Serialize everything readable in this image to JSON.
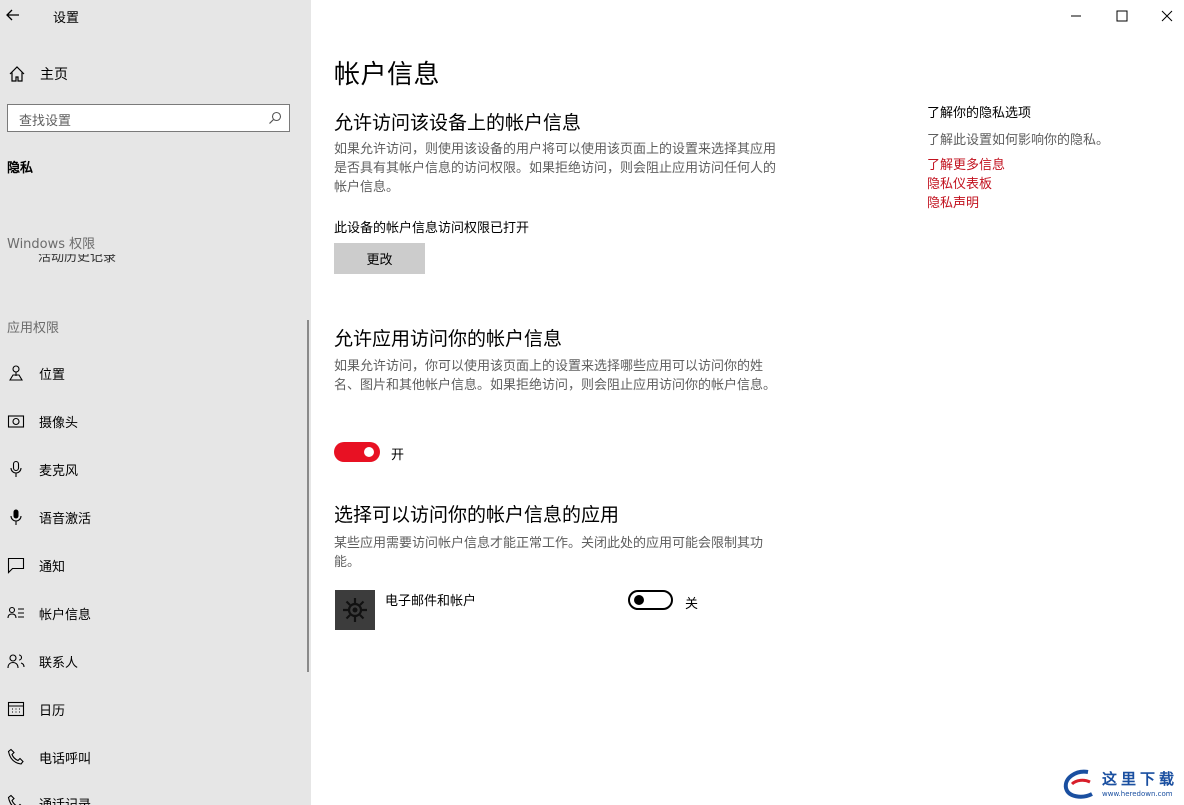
{
  "window": {
    "title": "设置"
  },
  "sidebar": {
    "home_label": "主页",
    "search_placeholder": "查找设置",
    "privacy_heading": "隐私",
    "windows_permissions_heading": "Windows 权限",
    "cut_item_label": "活动历史记录",
    "app_permissions_heading": "应用权限",
    "items": [
      {
        "label": "位置",
        "icon": "location-icon"
      },
      {
        "label": "摄像头",
        "icon": "camera-icon"
      },
      {
        "label": "麦克风",
        "icon": "microphone-icon"
      },
      {
        "label": "语音激活",
        "icon": "voice-activation-icon"
      },
      {
        "label": "通知",
        "icon": "notification-icon"
      },
      {
        "label": "帐户信息",
        "icon": "account-info-icon"
      },
      {
        "label": "联系人",
        "icon": "contacts-icon"
      },
      {
        "label": "日历",
        "icon": "calendar-icon"
      },
      {
        "label": "电话呼叫",
        "icon": "phone-icon"
      },
      {
        "label": "通话记录",
        "icon": "call-history-icon"
      }
    ]
  },
  "main": {
    "title": "帐户信息",
    "section1": {
      "heading": "允许访问该设备上的帐户信息",
      "description": "如果允许访问，则使用该设备的用户将可以使用该页面上的设置来选择其应用是否具有其帐户信息的访问权限。如果拒绝访问，则会阻止应用访问任何人的帐户信息。",
      "status": "此设备的帐户信息访问权限已打开",
      "button_label": "更改"
    },
    "section2": {
      "heading": "允许应用访问你的帐户信息",
      "description": "如果允许访问，你可以使用该页面上的设置来选择哪些应用可以访问你的姓名、图片和其他帐户信息。如果拒绝访问，则会阻止应用访问你的帐户信息。",
      "toggle_state": "开",
      "toggle_on": true
    },
    "section3": {
      "heading": "选择可以访问你的帐户信息的应用",
      "description": "某些应用需要访问帐户信息才能正常工作。关闭此处的应用可能会限制其功能。",
      "apps": [
        {
          "name": "电子邮件和帐户",
          "toggle_state": "关",
          "toggle_on": false,
          "icon": "gear-icon"
        }
      ]
    }
  },
  "aside": {
    "title": "了解你的隐私选项",
    "description": "了解此设置如何影响你的隐私。",
    "links": [
      "了解更多信息",
      "隐私仪表板",
      "隐私声明"
    ]
  },
  "watermark": {
    "text": "这里下载",
    "url_text": "www.heredown.com"
  },
  "colors": {
    "accent": "#e81123",
    "link": "#c2121f",
    "sidebar_bg": "#e6e6e6"
  }
}
